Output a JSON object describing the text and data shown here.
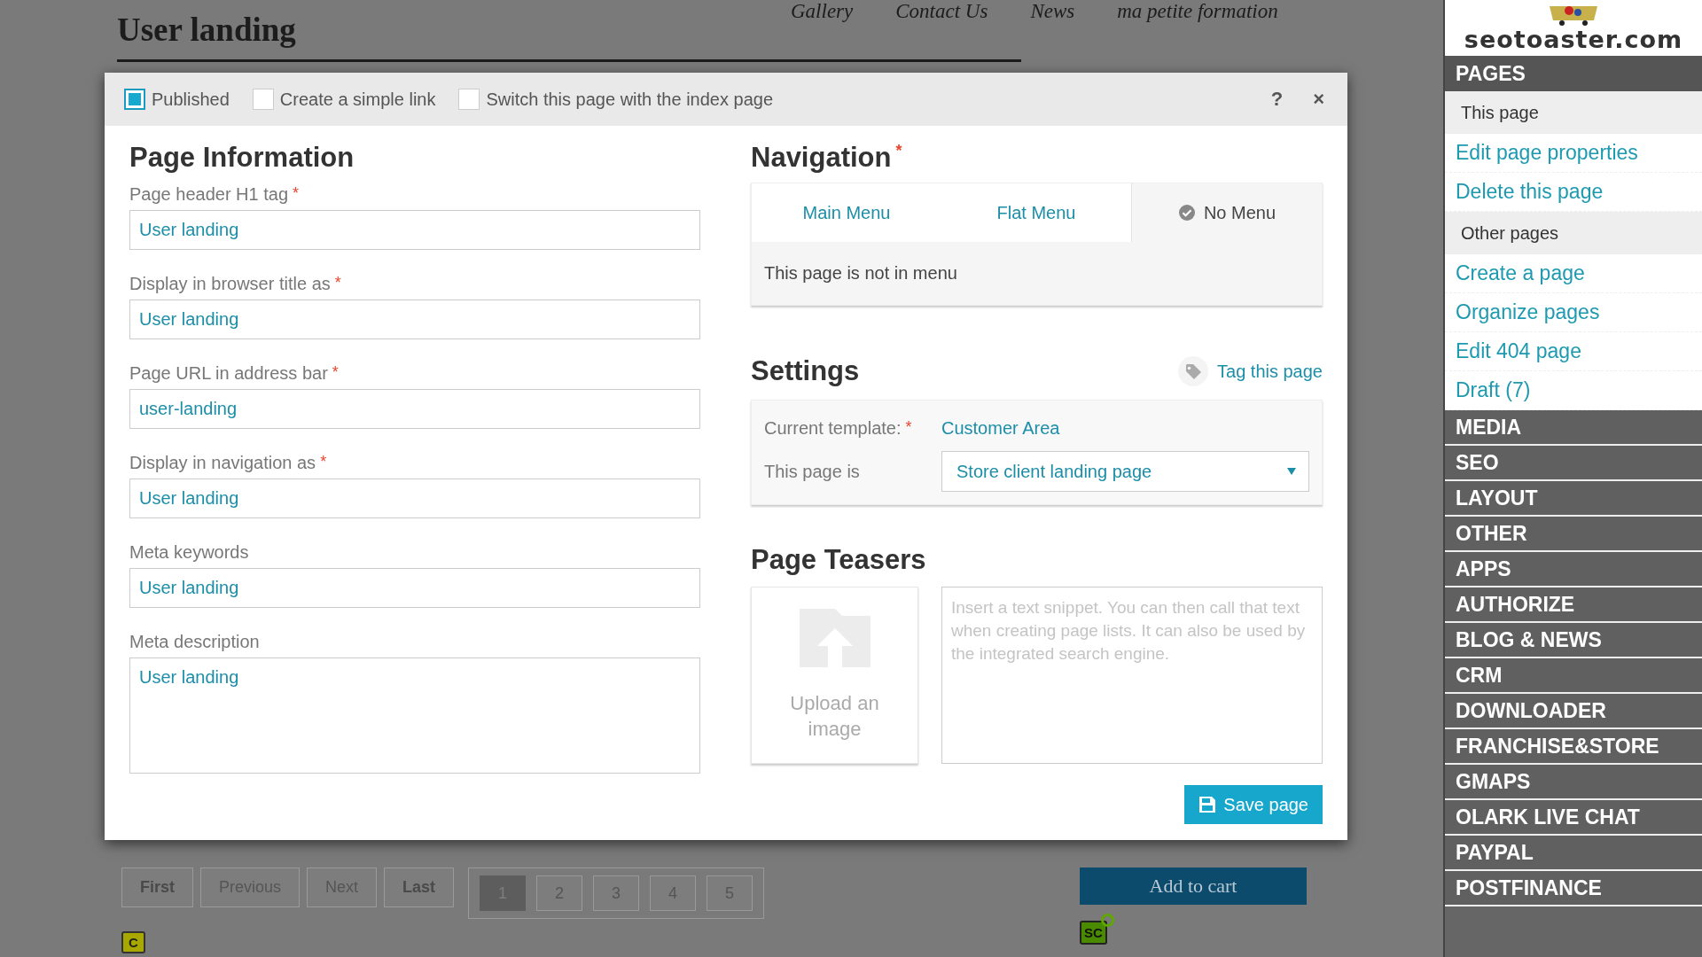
{
  "background_page": {
    "title": "User landing",
    "nav_links": [
      "Gallery",
      "Contact Us",
      "News",
      "ma petite formation"
    ],
    "pagination": {
      "buttons": [
        {
          "label": "First",
          "disabled": false
        },
        {
          "label": "Previous",
          "disabled": true
        },
        {
          "label": "Next",
          "disabled": true
        },
        {
          "label": "Last",
          "disabled": false
        }
      ],
      "pages": [
        {
          "label": "1",
          "selected": true
        },
        {
          "label": "2",
          "selected": false
        },
        {
          "label": "3",
          "selected": false
        },
        {
          "label": "4",
          "selected": false
        },
        {
          "label": "5",
          "selected": false
        }
      ]
    },
    "add_to_cart": "Add to cart",
    "edit_badge": "C",
    "shortcode_badge": "SC"
  },
  "dialog": {
    "options": [
      {
        "label": "Published",
        "checked": true
      },
      {
        "label": "Create a simple link",
        "checked": false
      },
      {
        "label": "Switch this page with the index page",
        "checked": false
      }
    ],
    "help": "?",
    "close": "×",
    "page_information": {
      "title": "Page Information",
      "fields": [
        {
          "label": "Page header H1 tag",
          "required_mark": "*",
          "value": "User landing",
          "kind": "input"
        },
        {
          "label": "Display in browser title as",
          "required_mark": "*",
          "value": "User landing",
          "kind": "input"
        },
        {
          "label": "Page URL in address bar",
          "required_mark": "*",
          "value": "user-landing",
          "kind": "input"
        },
        {
          "label": "Display in navigation as",
          "required_mark": "*",
          "value": "User landing",
          "kind": "input"
        },
        {
          "label": "Meta keywords",
          "value": "User landing",
          "kind": "input"
        },
        {
          "label": "Meta description",
          "value": "User landing",
          "kind": "textarea"
        }
      ]
    },
    "navigation": {
      "title": "Navigation",
      "required_mark": "*",
      "tabs": [
        {
          "label": "Main Menu",
          "selected": false
        },
        {
          "label": "Flat Menu",
          "selected": false
        },
        {
          "label": "No Menu",
          "selected": true
        }
      ],
      "message": "This page is not in menu"
    },
    "settings": {
      "title": "Settings",
      "tag_link": "Tag this page",
      "template_label": "Current template:",
      "template_required_mark": "*",
      "template_value": "Customer Area",
      "page_type_label": "This page is",
      "page_type_value": "Store client landing page"
    },
    "teasers": {
      "title": "Page Teasers",
      "upload_label": "Upload an image",
      "snippet_placeholder": "Insert a text snippet. You can then call that text when creating page lists. It can also be used by the integrated search engine."
    },
    "save_button": "Save page"
  },
  "sidebar": {
    "logo_text": "seotoaster.com",
    "sections": [
      {
        "title": "PAGES",
        "groups": [
          {
            "title": "This page",
            "links": [
              "Edit page properties",
              "Delete this page"
            ]
          },
          {
            "title": "Other pages",
            "links": [
              "Create a page",
              "Organize pages",
              "Edit 404 page",
              "Draft (7)"
            ]
          }
        ]
      },
      {
        "title": "MEDIA"
      },
      {
        "title": "SEO"
      },
      {
        "title": "LAYOUT"
      },
      {
        "title": "OTHER"
      },
      {
        "title": "APPS"
      },
      {
        "title": "AUTHORIZE"
      },
      {
        "title": "BLOG & NEWS"
      },
      {
        "title": "CRM"
      },
      {
        "title": "DOWNLOADER"
      },
      {
        "title": "FRANCHISE&STORE"
      },
      {
        "title": "GMAPS"
      },
      {
        "title": "OLARK LIVE CHAT"
      },
      {
        "title": "PAYPAL"
      },
      {
        "title": "POSTFINANCE"
      }
    ]
  }
}
